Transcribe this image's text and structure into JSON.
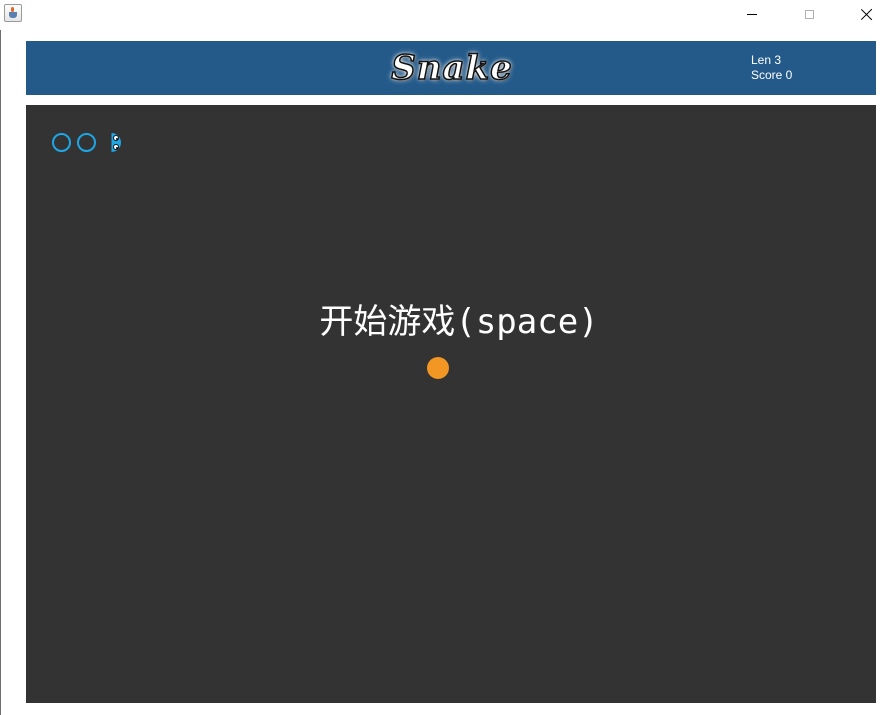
{
  "window": {
    "app_icon": "java-cup-icon",
    "controls": [
      "minimize-icon",
      "maximize-icon",
      "close-icon"
    ]
  },
  "header": {
    "title": "Snake",
    "len_text": "Len 3",
    "score_text": "Score 0",
    "background_color": "#245a8a"
  },
  "board": {
    "background_color": "#333333",
    "message": "开始游戏(space)",
    "snake_length": 3,
    "snake_color": "#1ea7e6",
    "food_color": "#f29624"
  }
}
